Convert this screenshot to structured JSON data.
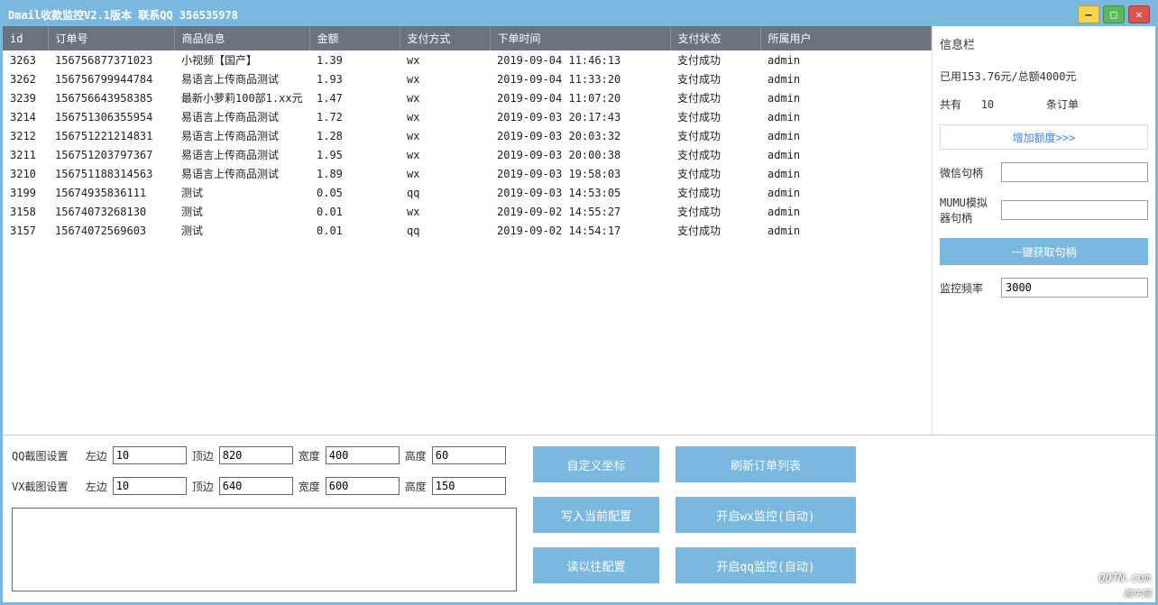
{
  "title": "Dmail收款监控V2.1版本 联系QQ 356535978",
  "columns": [
    "id",
    "订单号",
    "商品信息",
    "金额",
    "支付方式",
    "下单时间",
    "支付状态",
    "所属用户"
  ],
  "rows": [
    {
      "id": "3263",
      "order": "156756877371023",
      "product": "小视频【国产】",
      "amount": "1.39",
      "pay": "wx",
      "time": "2019-09-04 11:46:13",
      "status": "支付成功",
      "user": "admin"
    },
    {
      "id": "3262",
      "order": "156756799944784",
      "product": "易语言上传商品测试",
      "amount": "1.93",
      "pay": "wx",
      "time": "2019-09-04 11:33:20",
      "status": "支付成功",
      "user": "admin"
    },
    {
      "id": "3239",
      "order": "156756643958385",
      "product": "最新小萝莉100部1.xx元",
      "amount": "1.47",
      "pay": "wx",
      "time": "2019-09-04 11:07:20",
      "status": "支付成功",
      "user": "admin"
    },
    {
      "id": "3214",
      "order": "156751306355954",
      "product": "易语言上传商品测试",
      "amount": "1.72",
      "pay": "wx",
      "time": "2019-09-03 20:17:43",
      "status": "支付成功",
      "user": "admin"
    },
    {
      "id": "3212",
      "order": "156751221214831",
      "product": "易语言上传商品测试",
      "amount": "1.28",
      "pay": "wx",
      "time": "2019-09-03 20:03:32",
      "status": "支付成功",
      "user": "admin"
    },
    {
      "id": "3211",
      "order": "156751203797367",
      "product": "易语言上传商品测试",
      "amount": "1.95",
      "pay": "wx",
      "time": "2019-09-03 20:00:38",
      "status": "支付成功",
      "user": "admin"
    },
    {
      "id": "3210",
      "order": "156751188314563",
      "product": "易语言上传商品测试",
      "amount": "1.89",
      "pay": "wx",
      "time": "2019-09-03 19:58:03",
      "status": "支付成功",
      "user": "admin"
    },
    {
      "id": "3199",
      "order": "15674935836111",
      "product": "测试",
      "amount": "0.05",
      "pay": "qq",
      "time": "2019-09-03 14:53:05",
      "status": "支付成功",
      "user": "admin"
    },
    {
      "id": "3158",
      "order": "15674073268130",
      "product": "测试",
      "amount": "0.01",
      "pay": "wx",
      "time": "2019-09-02 14:55:27",
      "status": "支付成功",
      "user": "admin"
    },
    {
      "id": "3157",
      "order": "15674072569603",
      "product": "测试",
      "amount": "0.01",
      "pay": "qq",
      "time": "2019-09-02 14:54:17",
      "status": "支付成功",
      "user": "admin"
    }
  ],
  "side": {
    "heading": "信息栏",
    "used_total": "已用153.76元/总额4000元",
    "count_prefix": "共有",
    "count": "10",
    "count_suffix": "条订单",
    "add_quota": "增加额度>>>",
    "wx_handle_label": "微信句柄",
    "wx_handle_value": "",
    "mumu_handle_label": "MUMU模拟器句柄",
    "mumu_handle_value": "",
    "get_handle_btn": "一键获取句柄",
    "freq_label": "监控频率",
    "freq_value": "3000"
  },
  "lower": {
    "qq_label": "QQ截图设置",
    "vx_label": "VX截图设置",
    "left_label": "左边",
    "top_label": "顶边",
    "width_label": "宽度",
    "height_label": "高度",
    "qq": {
      "left": "10",
      "top": "820",
      "width": "400",
      "height": "60"
    },
    "vx": {
      "left": "10",
      "top": "640",
      "width": "600",
      "height": "150"
    },
    "buttons": {
      "custom_coord": "自定义坐标",
      "refresh_list": "刷新订单列表",
      "write_cfg": "写入当前配置",
      "start_wx": "开启wx监控(自动)",
      "read_cfg": "读以往配置",
      "start_qq": "开启qq监控(自动)"
    }
  },
  "watermark": {
    "main": "QQTN.com",
    "sub": "腾牛网"
  }
}
